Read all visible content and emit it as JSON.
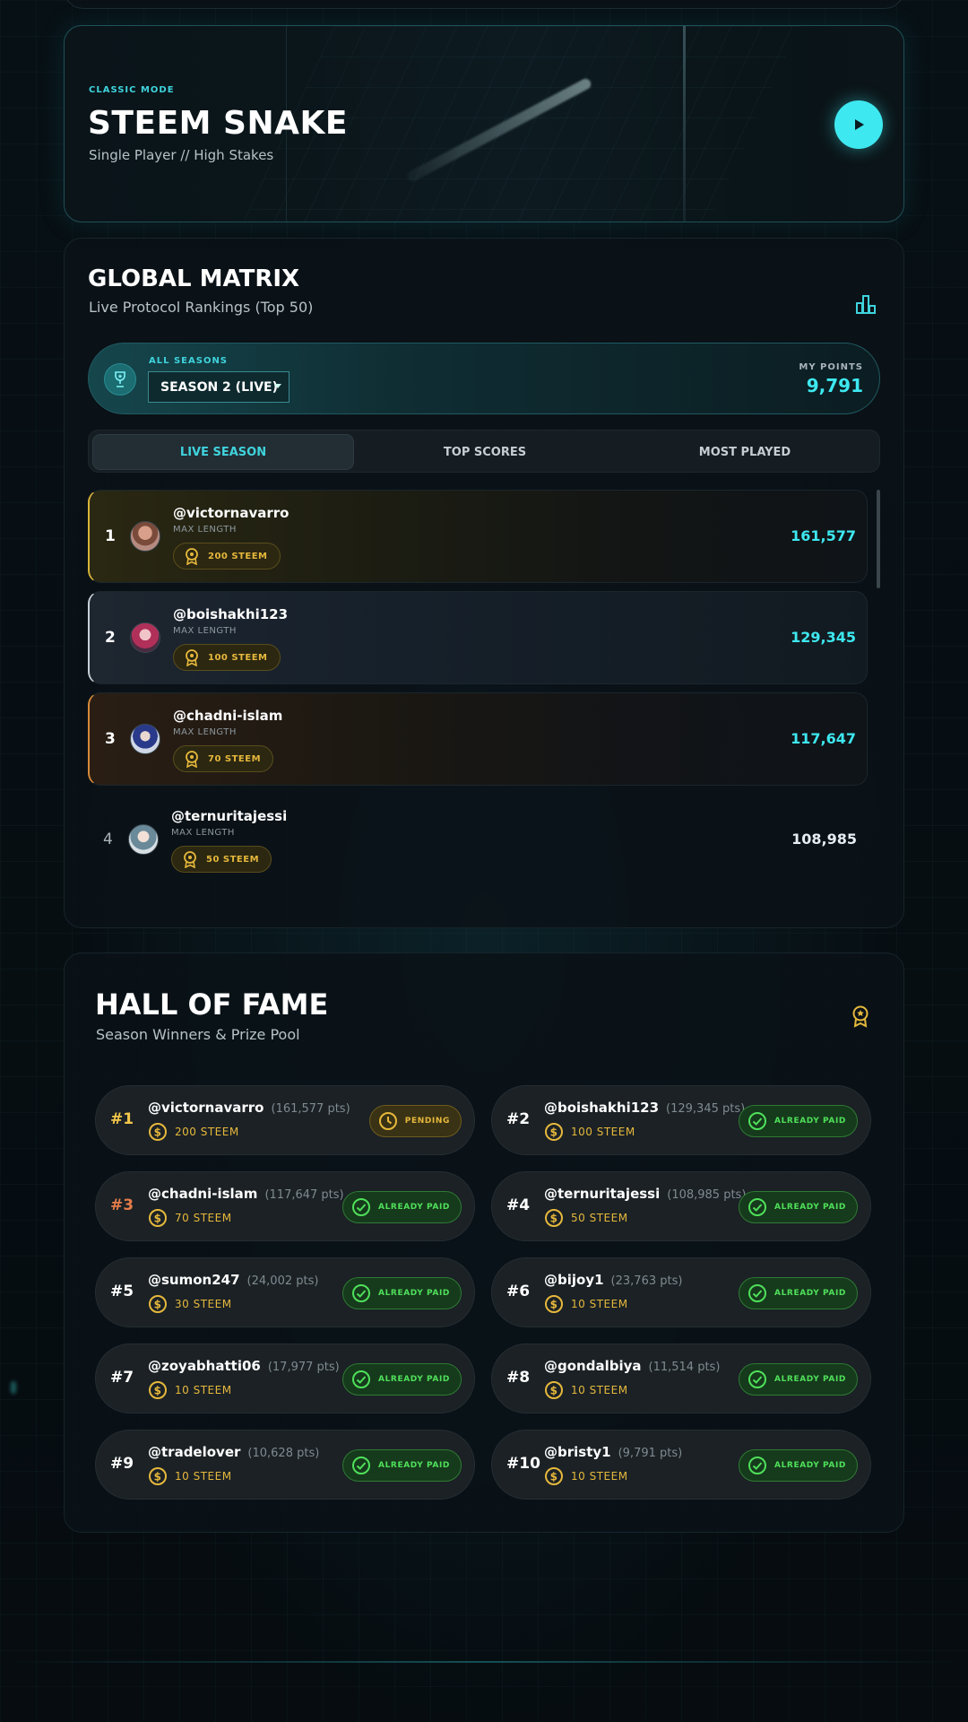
{
  "game": {
    "mode": "CLASSIC MODE",
    "title": "STEEM SNAKE",
    "subtitle": "Single Player // High Stakes"
  },
  "matrix": {
    "title": "GLOBAL MATRIX",
    "subtitle": "Live Protocol Rankings (Top 50)",
    "season_label": "ALL SEASONS",
    "season_selected": "SEASON 2 (LIVE)",
    "my_points_label": "MY POINTS",
    "my_points": "9,791",
    "tabs": [
      "LIVE SEASON",
      "TOP SCORES",
      "MOST PLAYED"
    ],
    "active_tab": "LIVE SEASON",
    "rows": [
      {
        "rank": "1",
        "user": "@victornavarro",
        "label": "MAX LENGTH",
        "prize": "200 STEEM",
        "score": "161,577"
      },
      {
        "rank": "2",
        "user": "@boishakhi123",
        "label": "MAX LENGTH",
        "prize": "100 STEEM",
        "score": "129,345"
      },
      {
        "rank": "3",
        "user": "@chadni-islam",
        "label": "MAX LENGTH",
        "prize": "70 STEEM",
        "score": "117,647"
      },
      {
        "rank": "4",
        "user": "@ternuritajessi",
        "label": "MAX LENGTH",
        "prize": "50 STEEM",
        "score": "108,985"
      }
    ]
  },
  "hof": {
    "title": "HALL OF FAME",
    "subtitle": "Season Winners & Prize Pool",
    "entries": [
      {
        "rank": "#1",
        "user": "@victornavarro",
        "pts": "(161,577 pts)",
        "prize": "200 STEEM",
        "status": "PENDING"
      },
      {
        "rank": "#2",
        "user": "@boishakhi123",
        "pts": "(129,345 pts)",
        "prize": "100 STEEM",
        "status": "ALREADY PAID"
      },
      {
        "rank": "#3",
        "user": "@chadni-islam",
        "pts": "(117,647 pts)",
        "prize": "70 STEEM",
        "status": "ALREADY PAID"
      },
      {
        "rank": "#4",
        "user": "@ternuritajessi",
        "pts": "(108,985 pts)",
        "prize": "50 STEEM",
        "status": "ALREADY PAID"
      },
      {
        "rank": "#5",
        "user": "@sumon247",
        "pts": "(24,002 pts)",
        "prize": "30 STEEM",
        "status": "ALREADY PAID"
      },
      {
        "rank": "#6",
        "user": "@bijoy1",
        "pts": "(23,763 pts)",
        "prize": "10 STEEM",
        "status": "ALREADY PAID"
      },
      {
        "rank": "#7",
        "user": "@zoyabhatti06",
        "pts": "(17,977 pts)",
        "prize": "10 STEEM",
        "status": "ALREADY PAID"
      },
      {
        "rank": "#8",
        "user": "@gondalbiya",
        "pts": "(11,514 pts)",
        "prize": "10 STEEM",
        "status": "ALREADY PAID"
      },
      {
        "rank": "#9",
        "user": "@tradelover",
        "pts": "(10,628 pts)",
        "prize": "10 STEEM",
        "status": "ALREADY PAID"
      },
      {
        "rank": "#10",
        "user": "@bristy1",
        "pts": "(9,791 pts)",
        "prize": "10 STEEM",
        "status": "ALREADY PAID"
      }
    ]
  },
  "colors": {
    "accent": "#3ee8f0",
    "gold": "#e6b83c",
    "paid": "#4fe05a"
  }
}
